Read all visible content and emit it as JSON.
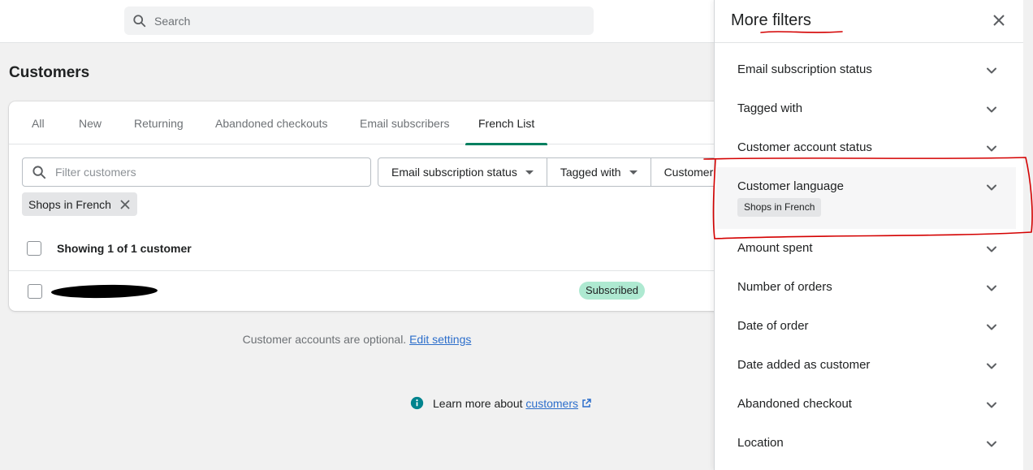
{
  "topbar": {
    "search_placeholder": "Search"
  },
  "page": {
    "title": "Customers"
  },
  "tabs": [
    {
      "label": "All"
    },
    {
      "label": "New"
    },
    {
      "label": "Returning"
    },
    {
      "label": "Abandoned checkouts"
    },
    {
      "label": "Email subscribers"
    },
    {
      "label": "French List",
      "active": true
    }
  ],
  "filters": {
    "input_placeholder": "Filter customers",
    "buttons": [
      "Email subscription status",
      "Tagged with",
      "Customer"
    ],
    "applied_chip": "Shops in French"
  },
  "list": {
    "showing": "Showing 1 of 1 customer",
    "rows": [
      {
        "status": "Subscribed"
      }
    ]
  },
  "footer": {
    "note": "Customer accounts are optional.",
    "note_link": "Edit settings",
    "learn_text": "Learn more about",
    "learn_link": "customers"
  },
  "panel": {
    "title": "More filters",
    "sections": [
      {
        "label": "Email subscription status"
      },
      {
        "label": "Tagged with"
      },
      {
        "label": "Customer account status"
      },
      {
        "label": "Customer language",
        "expanded": true,
        "selected": "Shops in French"
      },
      {
        "label": "Amount spent"
      },
      {
        "label": "Number of orders"
      },
      {
        "label": "Date of order"
      },
      {
        "label": "Date added as customer"
      },
      {
        "label": "Abandoned checkout"
      },
      {
        "label": "Location"
      }
    ]
  },
  "colors": {
    "accent": "#008060",
    "link": "#2c6ecb",
    "badge_success": "#aee9d1",
    "annotation_red": "#d40000"
  }
}
